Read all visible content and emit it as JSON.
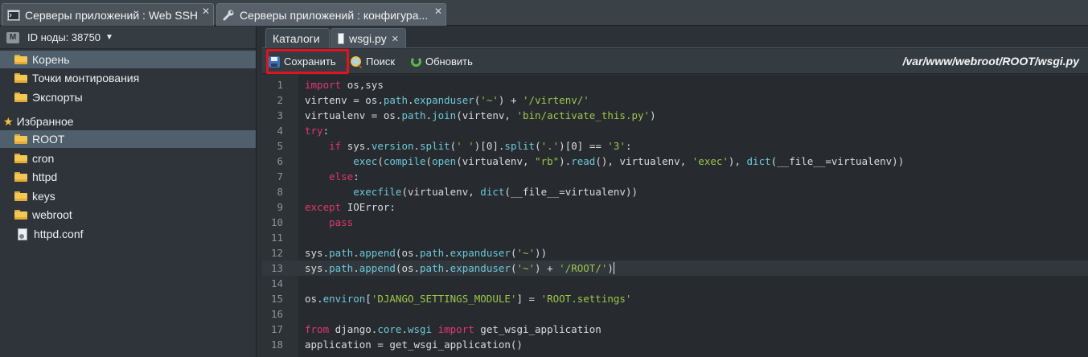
{
  "window_tabs": [
    {
      "label": "Серверы приложений : Web SSH",
      "close": "✕"
    },
    {
      "label": "Серверы приложений : конфигура...",
      "close": "✕"
    }
  ],
  "sidebar": {
    "node_label": "ID ноды: 38750",
    "node_badge": "M",
    "tree": [
      {
        "label": "Корень",
        "icon": "folder-icon"
      },
      {
        "label": "Точки монтирования",
        "icon": "folder-icon"
      },
      {
        "label": "Экспорты",
        "icon": "folder-icon"
      }
    ],
    "favorites_label": "Избранное",
    "favorites": [
      {
        "label": "ROOT",
        "icon": "folder-icon"
      },
      {
        "label": "cron",
        "icon": "folder-icon"
      },
      {
        "label": "httpd",
        "icon": "folder-icon"
      },
      {
        "label": "keys",
        "icon": "folder-icon"
      },
      {
        "label": "webroot",
        "icon": "folder-icon"
      },
      {
        "label": "httpd.conf",
        "icon": "file-icon"
      }
    ]
  },
  "editor_tabs": [
    {
      "label": "Каталоги"
    },
    {
      "label": "wsgi.py",
      "close": "✕"
    }
  ],
  "toolbar": {
    "save_label": "Сохранить",
    "search_label": "Поиск",
    "refresh_label": "Обновить",
    "file_path": "/var/www/webroot/ROOT/wsgi.py"
  },
  "code": {
    "current_line": 13,
    "lines": [
      "import os,sys",
      "virtenv = os.path.expanduser('~') + '/virtenv/'",
      "virtualenv = os.path.join(virtenv, 'bin/activate_this.py')",
      "try:",
      "    if sys.version.split(' ')[0].split('.')[0] == '3':",
      "        exec(compile(open(virtualenv, \"rb\").read(), virtualenv, 'exec'), dict(__file__=virtualenv))",
      "    else:",
      "        execfile(virtualenv, dict(__file__=virtualenv))",
      "except IOError:",
      "    pass",
      "",
      "sys.path.append(os.path.expanduser('~'))",
      "sys.path.append(os.path.expanduser('~') + '/ROOT/')",
      "",
      "os.environ['DJANGO_SETTINGS_MODULE'] = 'ROOT.settings'",
      "",
      "from django.core.wsgi import get_wsgi_application",
      "application = get_wsgi_application()"
    ]
  },
  "colors": {
    "keyword": "#e3366d",
    "string": "#9cc64a",
    "function": "#6cc7d8",
    "highlight_border": "#e0141e"
  }
}
